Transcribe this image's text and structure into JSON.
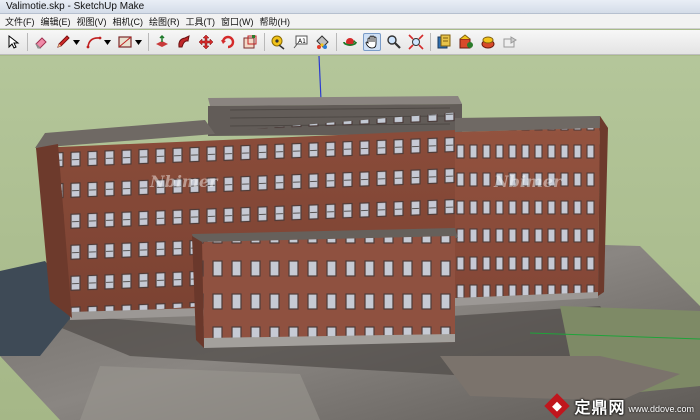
{
  "window": {
    "title": "Valimotie.skp - SketchUp Make"
  },
  "menu": [
    "文件(F)",
    "编辑(E)",
    "视图(V)",
    "相机(C)",
    "绘图(R)",
    "工具(T)",
    "窗口(W)",
    "帮助(H)"
  ],
  "toolbar": {
    "icons": [
      "select-icon",
      "eraser-icon",
      "pencil-icon",
      "arc-icon",
      "rectangle-icon",
      "pushpull-icon",
      "followme-icon",
      "move-icon",
      "rotate-icon",
      "scale-icon",
      "tape-measure-icon",
      "text-icon",
      "paint-bucket-icon",
      "orbit-icon",
      "pan-icon",
      "zoom-icon",
      "zoom-extents-icon",
      "components-icon",
      "warehouse-icon",
      "share-icon",
      "extension-icon"
    ],
    "active": "pan-icon"
  },
  "watermarks": [
    "Nbimer",
    "Nbimer"
  ],
  "brand": {
    "name": "定鼎网",
    "domain": "www.ddove.com"
  },
  "colors": {
    "sky": "#b4c69a",
    "brick": "#8f4f3b",
    "roof": "#6b6560",
    "window": "#c9d1dc"
  }
}
